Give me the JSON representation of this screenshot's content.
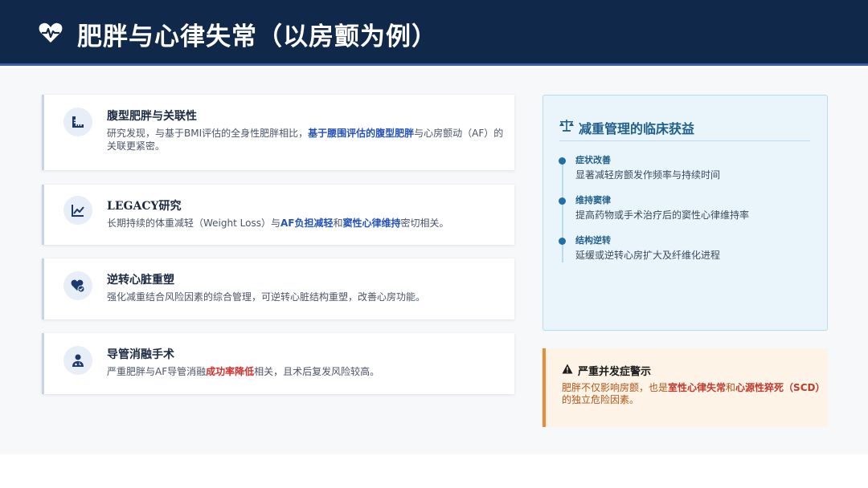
{
  "header": {
    "title": "肥胖与心律失常（以房颤为例）",
    "icon": "heart-pulse-icon"
  },
  "cards": [
    {
      "icon": "ruler-icon",
      "title": "腹型肥胖与关联性",
      "body": {
        "t1": "研究发现，与基于BMI评估的全身性肥胖相比，",
        "h1": "基于腰围评估的腹型肥胖",
        "t2": "与心房颤动（AF）的关联更紧密。"
      }
    },
    {
      "icon": "chart-line-icon",
      "title": "LEGACY研究",
      "body": {
        "t1": "长期持续的体重减轻（Weight Loss）与",
        "h1": "AF负担减轻",
        "t2": "和",
        "h2": "窦性心律维持",
        "t3": "密切相关。"
      }
    },
    {
      "icon": "heart-check-icon",
      "title": "逆转心脏重塑",
      "body": {
        "t1": "强化减重结合风险因素的综合管理，可逆转心脏结构重塑，改善心房功能。"
      }
    },
    {
      "icon": "doctor-icon",
      "title": "导管消融手术",
      "body": {
        "t1": "严重肥胖与AF导管消融",
        "h1": "成功率降低",
        "t2": "相关，且术后复发风险较高。"
      }
    }
  ],
  "benefits": {
    "icon": "balance-scale-icon",
    "title": "减重管理的临床获益",
    "items": [
      {
        "head": "症状改善",
        "text": "显著减轻房颤发作频率与持续时间"
      },
      {
        "head": "维持窦律",
        "text": "提高药物或手术治疗后的窦性心律维持率"
      },
      {
        "head": "结构逆转",
        "text": "延缓或逆转心房扩大及纤维化进程"
      }
    ]
  },
  "warning": {
    "icon": "warning-icon",
    "title": "严重并发症警示",
    "t1": "肥胖不仅影响房颤，也是",
    "h1": "室性心律失常",
    "t2": "和",
    "h2": "心源性猝死（SCD）",
    "t3": "的独立危险因素。"
  },
  "colors": {
    "header_bg": "#10284a",
    "accent_blue": "#2453b8",
    "accent_red": "#d32f2f",
    "warn_orange": "#ee8a33"
  }
}
